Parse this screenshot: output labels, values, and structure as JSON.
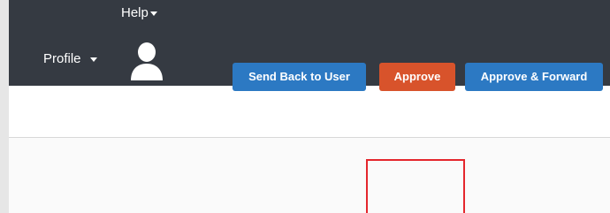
{
  "header": {
    "help_label": "Help",
    "profile_label": "Profile",
    "avatar_icon": "user-avatar-icon"
  },
  "actions": {
    "send_back_label": "Send Back to User",
    "approve_label": "Approve",
    "approve_forward_label": "Approve & Forward"
  },
  "colors": {
    "topbar": "#353a42",
    "primary_blue": "#2c79c3",
    "approve_orange": "#d8532b",
    "highlight_red": "#e4262c"
  }
}
